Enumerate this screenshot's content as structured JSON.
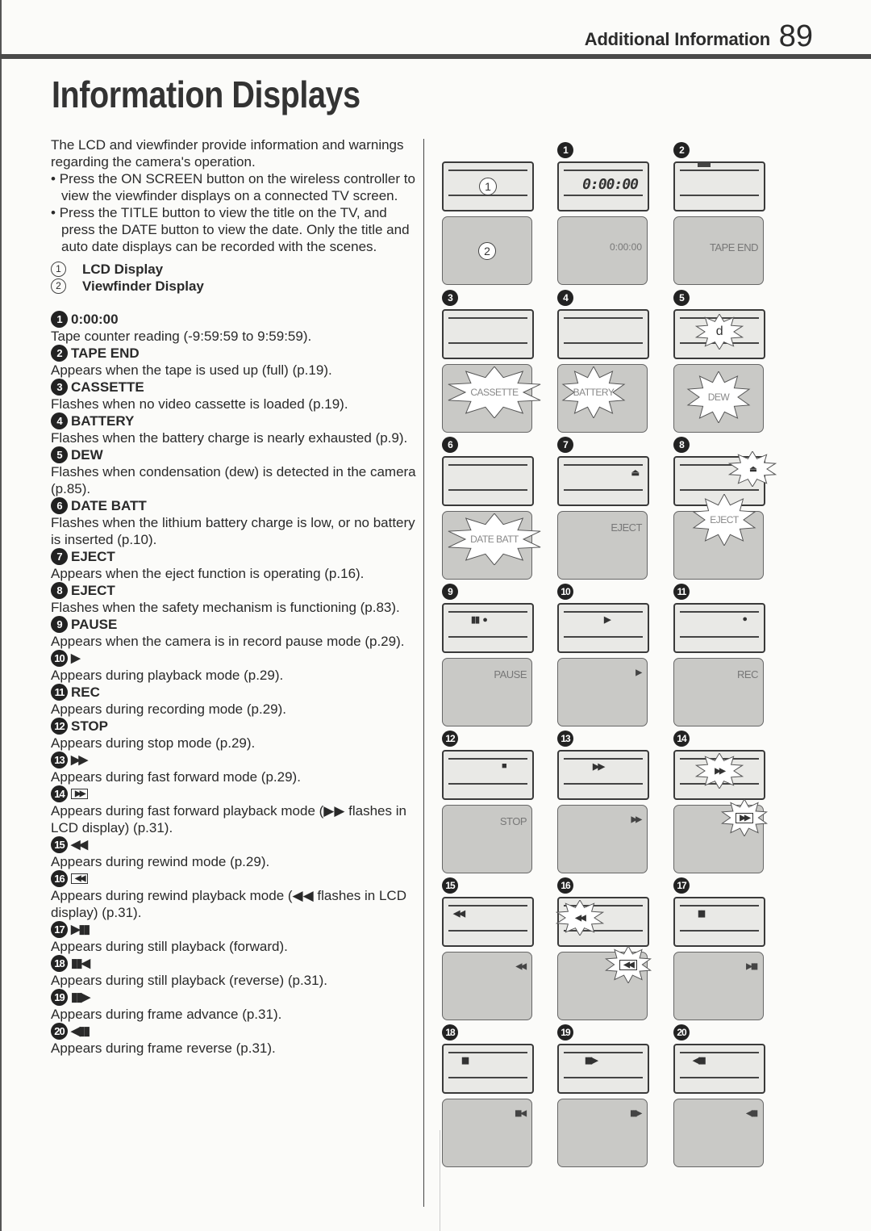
{
  "header": {
    "section": "Additional Information",
    "page_number": "89"
  },
  "page_title": "Information Displays",
  "intro": {
    "paragraph": "The LCD and viewfinder provide information and warnings regarding the camera's operation.",
    "bullets": [
      "Press the ON SCREEN button on the wireless controller to view the viewfinder displays on a connected TV screen.",
      "Press the TITLE button to view the title on the TV, and press the DATE button to view the date. Only the title and auto date displays can be recorded with the scenes."
    ]
  },
  "legend": [
    {
      "mark": "1",
      "label": "LCD Display"
    },
    {
      "mark": "2",
      "label": "Viewfinder Display"
    }
  ],
  "items": [
    {
      "num": "1",
      "title": "0:00:00",
      "desc": "Tape counter reading (-9:59:59 to 9:59:59)."
    },
    {
      "num": "2",
      "title": "TAPE END",
      "desc": "Appears when the tape is used up (full) (p.19)."
    },
    {
      "num": "3",
      "title": "CASSETTE",
      "desc": "Flashes when no video cassette is loaded (p.19)."
    },
    {
      "num": "4",
      "title": "BATTERY",
      "desc": "Flashes when the battery charge is nearly exhausted (p.9)."
    },
    {
      "num": "5",
      "title": "DEW",
      "desc": "Flashes when condensation (dew) is detected in the camera (p.85)."
    },
    {
      "num": "6",
      "title": "DATE BATT",
      "desc": "Flashes when the lithium battery charge is low, or no battery is inserted (p.10)."
    },
    {
      "num": "7",
      "title": "EJECT",
      "desc": "Appears when the eject function is operating (p.16)."
    },
    {
      "num": "8",
      "title": "EJECT",
      "desc": "Flashes when the safety mechanism is functioning (p.83)."
    },
    {
      "num": "9",
      "title": "PAUSE",
      "desc": "Appears when the camera is in record pause mode (p.29)."
    },
    {
      "num": "10",
      "title": "▶",
      "desc": "Appears during playback mode (p.29)."
    },
    {
      "num": "11",
      "title": "REC",
      "desc": "Appears during recording mode (p.29)."
    },
    {
      "num": "12",
      "title": "STOP",
      "desc": "Appears during stop mode (p.29)."
    },
    {
      "num": "13",
      "title": "▶▶",
      "desc": "Appears during fast forward mode (p.29)."
    },
    {
      "num": "14",
      "title": "▶▶",
      "boxed": true,
      "desc": "Appears during fast forward playback mode (▶▶ flashes in LCD display) (p.31)."
    },
    {
      "num": "15",
      "title": "◀◀",
      "desc": "Appears during rewind mode (p.29)."
    },
    {
      "num": "16",
      "title": "◀◀",
      "boxed": true,
      "desc": "Appears during rewind playback mode (◀◀ flashes in LCD display) (p.31)."
    },
    {
      "num": "17",
      "title": "▶▮▮",
      "desc": "Appears during still playback (forward)."
    },
    {
      "num": "18",
      "title": "▮▮◀",
      "desc": "Appears during still playback (reverse) (p.31)."
    },
    {
      "num": "19",
      "title": "▮▮▶",
      "desc": "Appears during frame advance (p.31)."
    },
    {
      "num": "20",
      "title": "◀▮▮",
      "desc": "Appears during frame reverse (p.31)."
    }
  ],
  "diagram": {
    "legend_cell": {
      "lcd_mark": "1",
      "vf_mark": "2"
    },
    "cells": [
      {
        "num": "1",
        "lcd": "0:00:00",
        "vf": "0:00:00"
      },
      {
        "num": "2",
        "lcd_icon": "tape-end-icon",
        "vf": "TAPE END"
      },
      {
        "num": "3",
        "lcd": "",
        "vf": "CASSETTE",
        "vf_flash": true
      },
      {
        "num": "4",
        "lcd": "",
        "vf": "BATTERY",
        "vf_flash": true
      },
      {
        "num": "5",
        "lcd": "d",
        "lcd_flash": true,
        "vf": "DEW",
        "vf_flash": true
      },
      {
        "num": "6",
        "lcd": "",
        "vf": "DATE BATT",
        "vf_flash": true
      },
      {
        "num": "7",
        "lcd": "⏏",
        "vf": "EJECT"
      },
      {
        "num": "8",
        "lcd": "⏏",
        "lcd_flash": true,
        "vf": "EJECT",
        "vf_flash": true
      },
      {
        "num": "9",
        "lcd": "▮▮  ●",
        "vf": "PAUSE"
      },
      {
        "num": "10",
        "lcd": "▶",
        "vf": "▶"
      },
      {
        "num": "11",
        "lcd": "●",
        "vf": "REC"
      },
      {
        "num": "12",
        "lcd": "■",
        "vf": "STOP"
      },
      {
        "num": "13",
        "lcd": "▶▶",
        "vf": "▶▶"
      },
      {
        "num": "14",
        "lcd": "▶▶",
        "lcd_flash": true,
        "vf": "▶▶",
        "vf_flash": true
      },
      {
        "num": "15",
        "lcd": "◀◀",
        "vf": "◀◀"
      },
      {
        "num": "16",
        "lcd": "◀◀",
        "lcd_flash": true,
        "vf": "◀◀",
        "vf_flash": true
      },
      {
        "num": "17",
        "lcd": "▮▮",
        "vf": "▶▮▮"
      },
      {
        "num": "18",
        "lcd": "▮▮",
        "vf": "▮▮◀"
      },
      {
        "num": "19",
        "lcd": "▮▮▶",
        "vf": "▮▮▶"
      },
      {
        "num": "20",
        "lcd": "◀▮▮",
        "vf": "◀▮▮"
      }
    ]
  }
}
